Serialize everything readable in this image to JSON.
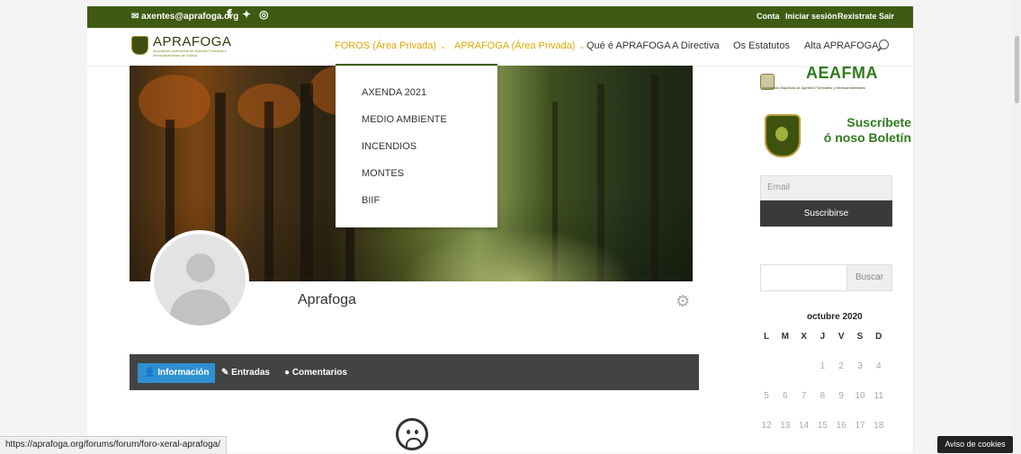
{
  "topbar": {
    "email": "axentes@aprafoga.org",
    "social": [
      "f",
      "✦",
      "◎"
    ],
    "links": [
      "Conta",
      "Iniciar sesión",
      "Rexistrate",
      "Sair"
    ]
  },
  "nav": {
    "logo_text": "APRAFOGA",
    "logo_sub": "Asociación profesional de Axentes Forestais e Medioambientais de Galicia",
    "items": [
      {
        "label": "FOROS (Área Privada)",
        "dropdown": true
      },
      {
        "label": "APRAFOGA (Área Privada)",
        "dropdown": true
      },
      {
        "label": "Qué é APRAFOGA"
      },
      {
        "label": "A Directiva"
      },
      {
        "label": "Os Estatutos"
      },
      {
        "label": "Alta APRAFOGA"
      }
    ]
  },
  "dropdown": {
    "items": [
      "AXENDA 2021",
      "MEDIO AMBIENTE",
      "INCENDIOS",
      "MONTES",
      "BIIF"
    ]
  },
  "profile": {
    "name": "Aprafoga",
    "tabs": [
      "Información",
      "Entradas",
      "Comentarios"
    ]
  },
  "sidebar": {
    "aeafma_title": "AEAFMA",
    "aeafma_sub": "Asociación Española de Agentes Forestales y Medioambientales",
    "subscribe_line1": "Suscríbete",
    "subscribe_line2": "ó noso Boletín",
    "email_placeholder": "Email",
    "subscribe_button": "Suscribirse",
    "search_button": "Buscar",
    "calendar": {
      "month": "octubre 2020",
      "weekdays": [
        "L",
        "M",
        "X",
        "J",
        "V",
        "S",
        "D"
      ],
      "rows": [
        [
          "",
          "",
          "",
          "1",
          "2",
          "3",
          "4"
        ],
        [
          "5",
          "6",
          "7",
          "8",
          "9",
          "10",
          "11"
        ],
        [
          "12",
          "13",
          "14",
          "15",
          "16",
          "17",
          "18"
        ]
      ]
    }
  },
  "status_url": "https://aprafoga.org/forums/forum/foro-xeral-aprafoga/",
  "cookie_button": "Aviso de cookies"
}
